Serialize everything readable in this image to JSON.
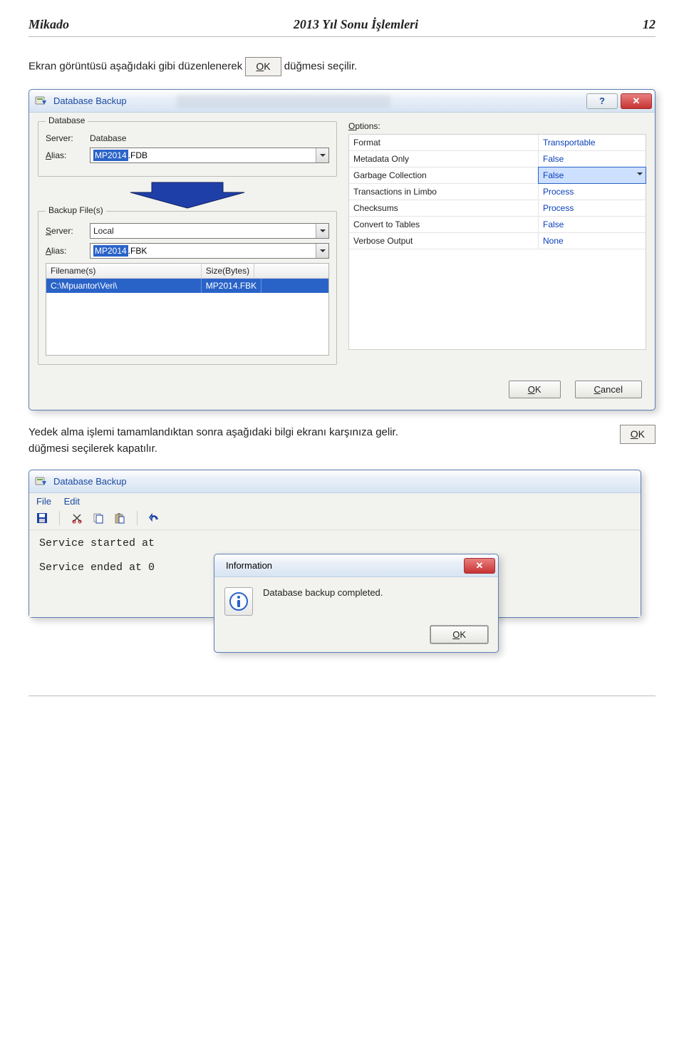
{
  "doc": {
    "brand": "Mikado",
    "heading": "2013 Yıl Sonu İşlemleri",
    "page": "12",
    "para1_a": "Ekran görüntüsü aşağıdaki gibi düzenlenerek ",
    "para1_b": " düğmesi seçilir.",
    "ok_label": "OK",
    "para2_a": "Yedek alma işlemi tamamlandıktan sonra aşağıdaki bilgi ekranı karşınıza gelir.",
    "para2_b": "düğmesi seçilerek kapatılır."
  },
  "dialog1": {
    "title": "Database Backup",
    "group_database": "Database",
    "group_backup": "Backup File(s)",
    "label_server": "Server:",
    "label_alias": "Alias:",
    "alias_u": "A",
    "server_u": "S",
    "db_server_value": "Database",
    "db_alias_sel": "MP2014",
    "db_alias_ext": ".FDB",
    "bk_server_value": "Local",
    "bk_alias_sel": "MP2014",
    "bk_alias_ext": ".FBK",
    "file_col1": "Filename(s)",
    "file_col2": "Size(Bytes)",
    "file_row_path": "C:\\Mpuantor\\Veri\\",
    "file_row_name": "MP2014.FBK",
    "options_label": "Options:",
    "options": [
      {
        "l": "Format",
        "r": "Transportable",
        "sel": false
      },
      {
        "l": "Metadata Only",
        "r": "False",
        "sel": false
      },
      {
        "l": "Garbage Collection",
        "r": "False",
        "sel": true
      },
      {
        "l": "Transactions in Limbo",
        "r": "Process",
        "sel": false
      },
      {
        "l": "Checksums",
        "r": "Process",
        "sel": false
      },
      {
        "l": "Convert to Tables",
        "r": "False",
        "sel": false
      },
      {
        "l": "Verbose Output",
        "r": "None",
        "sel": false
      }
    ],
    "btn_ok": "OK",
    "btn_cancel": "Cancel"
  },
  "dialog2": {
    "title": "Database Backup",
    "menu_file": "File",
    "menu_edit": "Edit",
    "console_line1": "Service started at ",
    "console_line2": "Service ended at 0"
  },
  "infoDialog": {
    "title": "Information",
    "message": "Database backup completed.",
    "btn_ok": "OK"
  }
}
